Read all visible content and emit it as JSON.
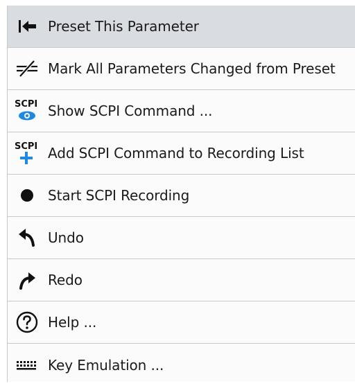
{
  "menu": {
    "items": [
      {
        "label": "Preset This Parameter",
        "icon": "preset-parameter-icon"
      },
      {
        "label": "Mark All Parameters Changed from Preset",
        "icon": "mark-changed-icon"
      },
      {
        "label": "Show SCPI Command ...",
        "icon": "scpi-show-icon",
        "icon_text": "SCPI"
      },
      {
        "label": "Add SCPI Command to Recording List",
        "icon": "scpi-add-icon",
        "icon_text": "SCPI"
      },
      {
        "label": "Start SCPI Recording",
        "icon": "record-dot-icon"
      },
      {
        "label": "Undo",
        "icon": "undo-icon"
      },
      {
        "label": "Redo",
        "icon": "redo-icon"
      },
      {
        "label": "Help ...",
        "icon": "help-icon"
      },
      {
        "label": "Key Emulation ...",
        "icon": "keyboard-icon"
      }
    ]
  },
  "colors": {
    "highlight": "#d9dce0",
    "accent_blue": "#1e88e5",
    "icon_dark": "#111111"
  }
}
